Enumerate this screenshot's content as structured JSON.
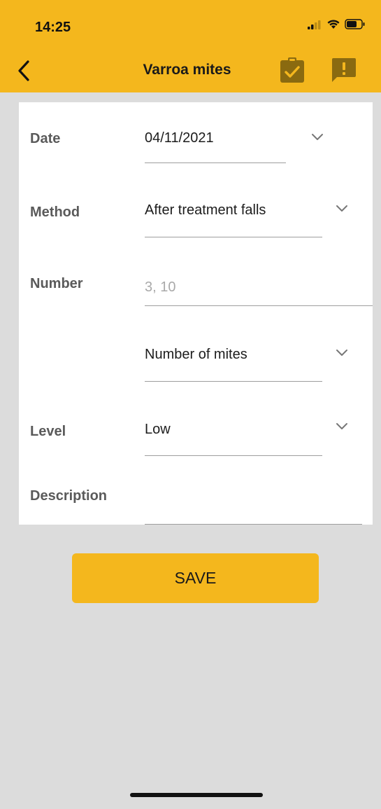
{
  "status_bar": {
    "time": "14:25",
    "icons": [
      "signal-icon",
      "wifi-icon",
      "battery-icon"
    ]
  },
  "header": {
    "title": "Varroa mites",
    "back_icon": "back-chevron-icon",
    "actions": [
      "clipboard-check-icon",
      "report-alert-icon"
    ]
  },
  "form": {
    "date": {
      "label": "Date",
      "value": "04/11/2021"
    },
    "method": {
      "label": "Method",
      "value": "After treatment falls"
    },
    "number": {
      "label": "Number",
      "placeholder": "3, 10"
    },
    "number_unit": {
      "value": "Number of mites"
    },
    "level": {
      "label": "Level",
      "value": "Low"
    },
    "description": {
      "label": "Description",
      "value": ""
    }
  },
  "save_button": {
    "label": "SAVE"
  },
  "colors": {
    "accent": "#f4b71d",
    "background": "#dcdcdc",
    "card": "#ffffff",
    "icon_dark": "#8a6a10"
  }
}
